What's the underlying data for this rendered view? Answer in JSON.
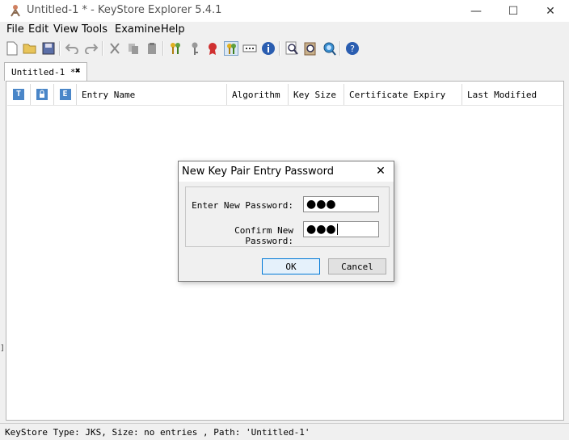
{
  "window": {
    "title": "Untitled-1 * - KeyStore Explorer 5.4.1",
    "controls": [
      "—",
      "☐",
      "✕"
    ]
  },
  "menu": [
    "File",
    "Edit",
    "View",
    "Tools",
    "Examine",
    "Help"
  ],
  "toolbar": {
    "icons": [
      "new-icon",
      "open-icon",
      "save-icon",
      "undo-icon",
      "redo-icon",
      "cut-icon",
      "copy-icon",
      "paste-icon",
      "generate-key-pair-icon",
      "generate-secret-key-icon",
      "import-trusted-certificate-icon",
      "import-key-pair-icon",
      "set-password-icon",
      "details-icon",
      "examine-file-icon",
      "examine-clipboard-icon",
      "examine-ssl-icon",
      "help-icon"
    ]
  },
  "tabs": [
    {
      "label": "Untitled-1 *",
      "close": "✖"
    }
  ],
  "table": {
    "icon_columns": [
      "T",
      "🔒",
      "E"
    ],
    "columns": [
      "Entry Name",
      "Algorithm",
      "Key Size",
      "Certificate Expiry",
      "Last Modified"
    ],
    "rows": []
  },
  "dialog": {
    "title": "New Key Pair Entry Password",
    "close": "✕",
    "fields": [
      {
        "label": "Enter New Password:",
        "value": "●●●"
      },
      {
        "label": "Confirm New Password:",
        "value": "●●●"
      }
    ],
    "ok": "OK",
    "cancel": "Cancel"
  },
  "status": "KeyStore Type: JKS, Size: no entries , Path: 'Untitled-1'",
  "colors": {
    "accent": "#0078d7",
    "tab_border": "#b4b4b4",
    "window_bg": "#f0f0f0"
  }
}
